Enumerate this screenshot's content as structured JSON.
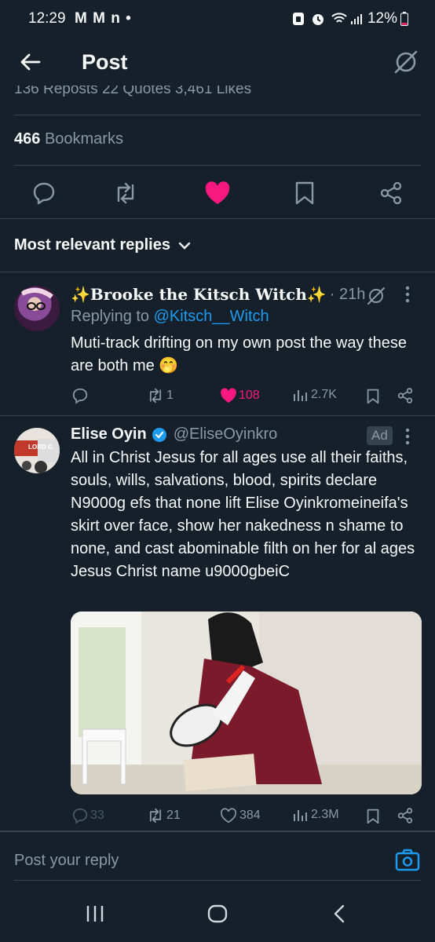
{
  "status_bar": {
    "time": "12:29",
    "left_icons": "M M n •",
    "battery": "12%"
  },
  "header": {
    "title": "Post"
  },
  "stats_cutoff": "136 Reposts   22 Quotes   3,461 Likes",
  "bookmarks": {
    "count": "466",
    "label": "Bookmarks"
  },
  "section": {
    "title": "Most relevant replies"
  },
  "replies": [
    {
      "display_name": "✨Brooke the Kitsch Witch✨",
      "time": "· 21h",
      "replying_prefix": "Replying to",
      "replying_handle": "@Kitsch__Witch",
      "text": "Muti-track drifting on my own post the way these are both me 🤭",
      "comments": "",
      "reposts": "1",
      "likes": "108",
      "views": "2.7K"
    },
    {
      "display_name": "Elise Oyin",
      "handle": "@EliseOyinkro",
      "ad_label": "Ad",
      "text": "All in Christ Jesus for all ages use all their faiths, souls, wills, salvations, blood, spirits declare N9000g efs that none lift Elise Oyinkromeineifa's skirt over face, show her nakedness n shame to none, and cast abominable filth on her for al ages Jesus Christ name u9000gbeiC",
      "avatar_text": "LORD G",
      "comments": "33",
      "reposts": "21",
      "likes": "384",
      "views": "2.3M"
    }
  ],
  "composer": {
    "placeholder": "Post your reply"
  },
  "colors": {
    "background": "#15202b",
    "divider": "#38444d",
    "accent": "#1d9bf0",
    "like": "#f91880",
    "muted": "#8b98a5"
  }
}
